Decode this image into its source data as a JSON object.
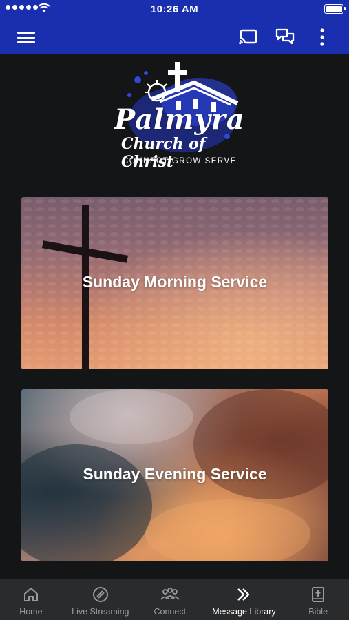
{
  "status_bar": {
    "time": "10:26 AM"
  },
  "app_bar": {
    "menu_icon": "hamburger-menu-icon",
    "actions": [
      "cast-icon",
      "chat-icon",
      "more-vertical-icon"
    ],
    "color": "#1a2fb0"
  },
  "logo": {
    "title": "Palmyra",
    "subtitle": "Church of Christ",
    "tagline": "CONNECT  GROW  SERVE"
  },
  "cards": [
    {
      "label": "Sunday Morning Service"
    },
    {
      "label": "Sunday Evening Service"
    }
  ],
  "tab_bar": {
    "tabs": [
      {
        "label": "Home",
        "icon": "home-icon"
      },
      {
        "label": "Live Streaming",
        "icon": "live-streaming-icon"
      },
      {
        "label": "Connect",
        "icon": "connect-group-icon"
      },
      {
        "label": "Message Library",
        "icon": "chevrons-right-icon",
        "active": true
      },
      {
        "label": "Bible",
        "icon": "bible-icon"
      }
    ]
  }
}
